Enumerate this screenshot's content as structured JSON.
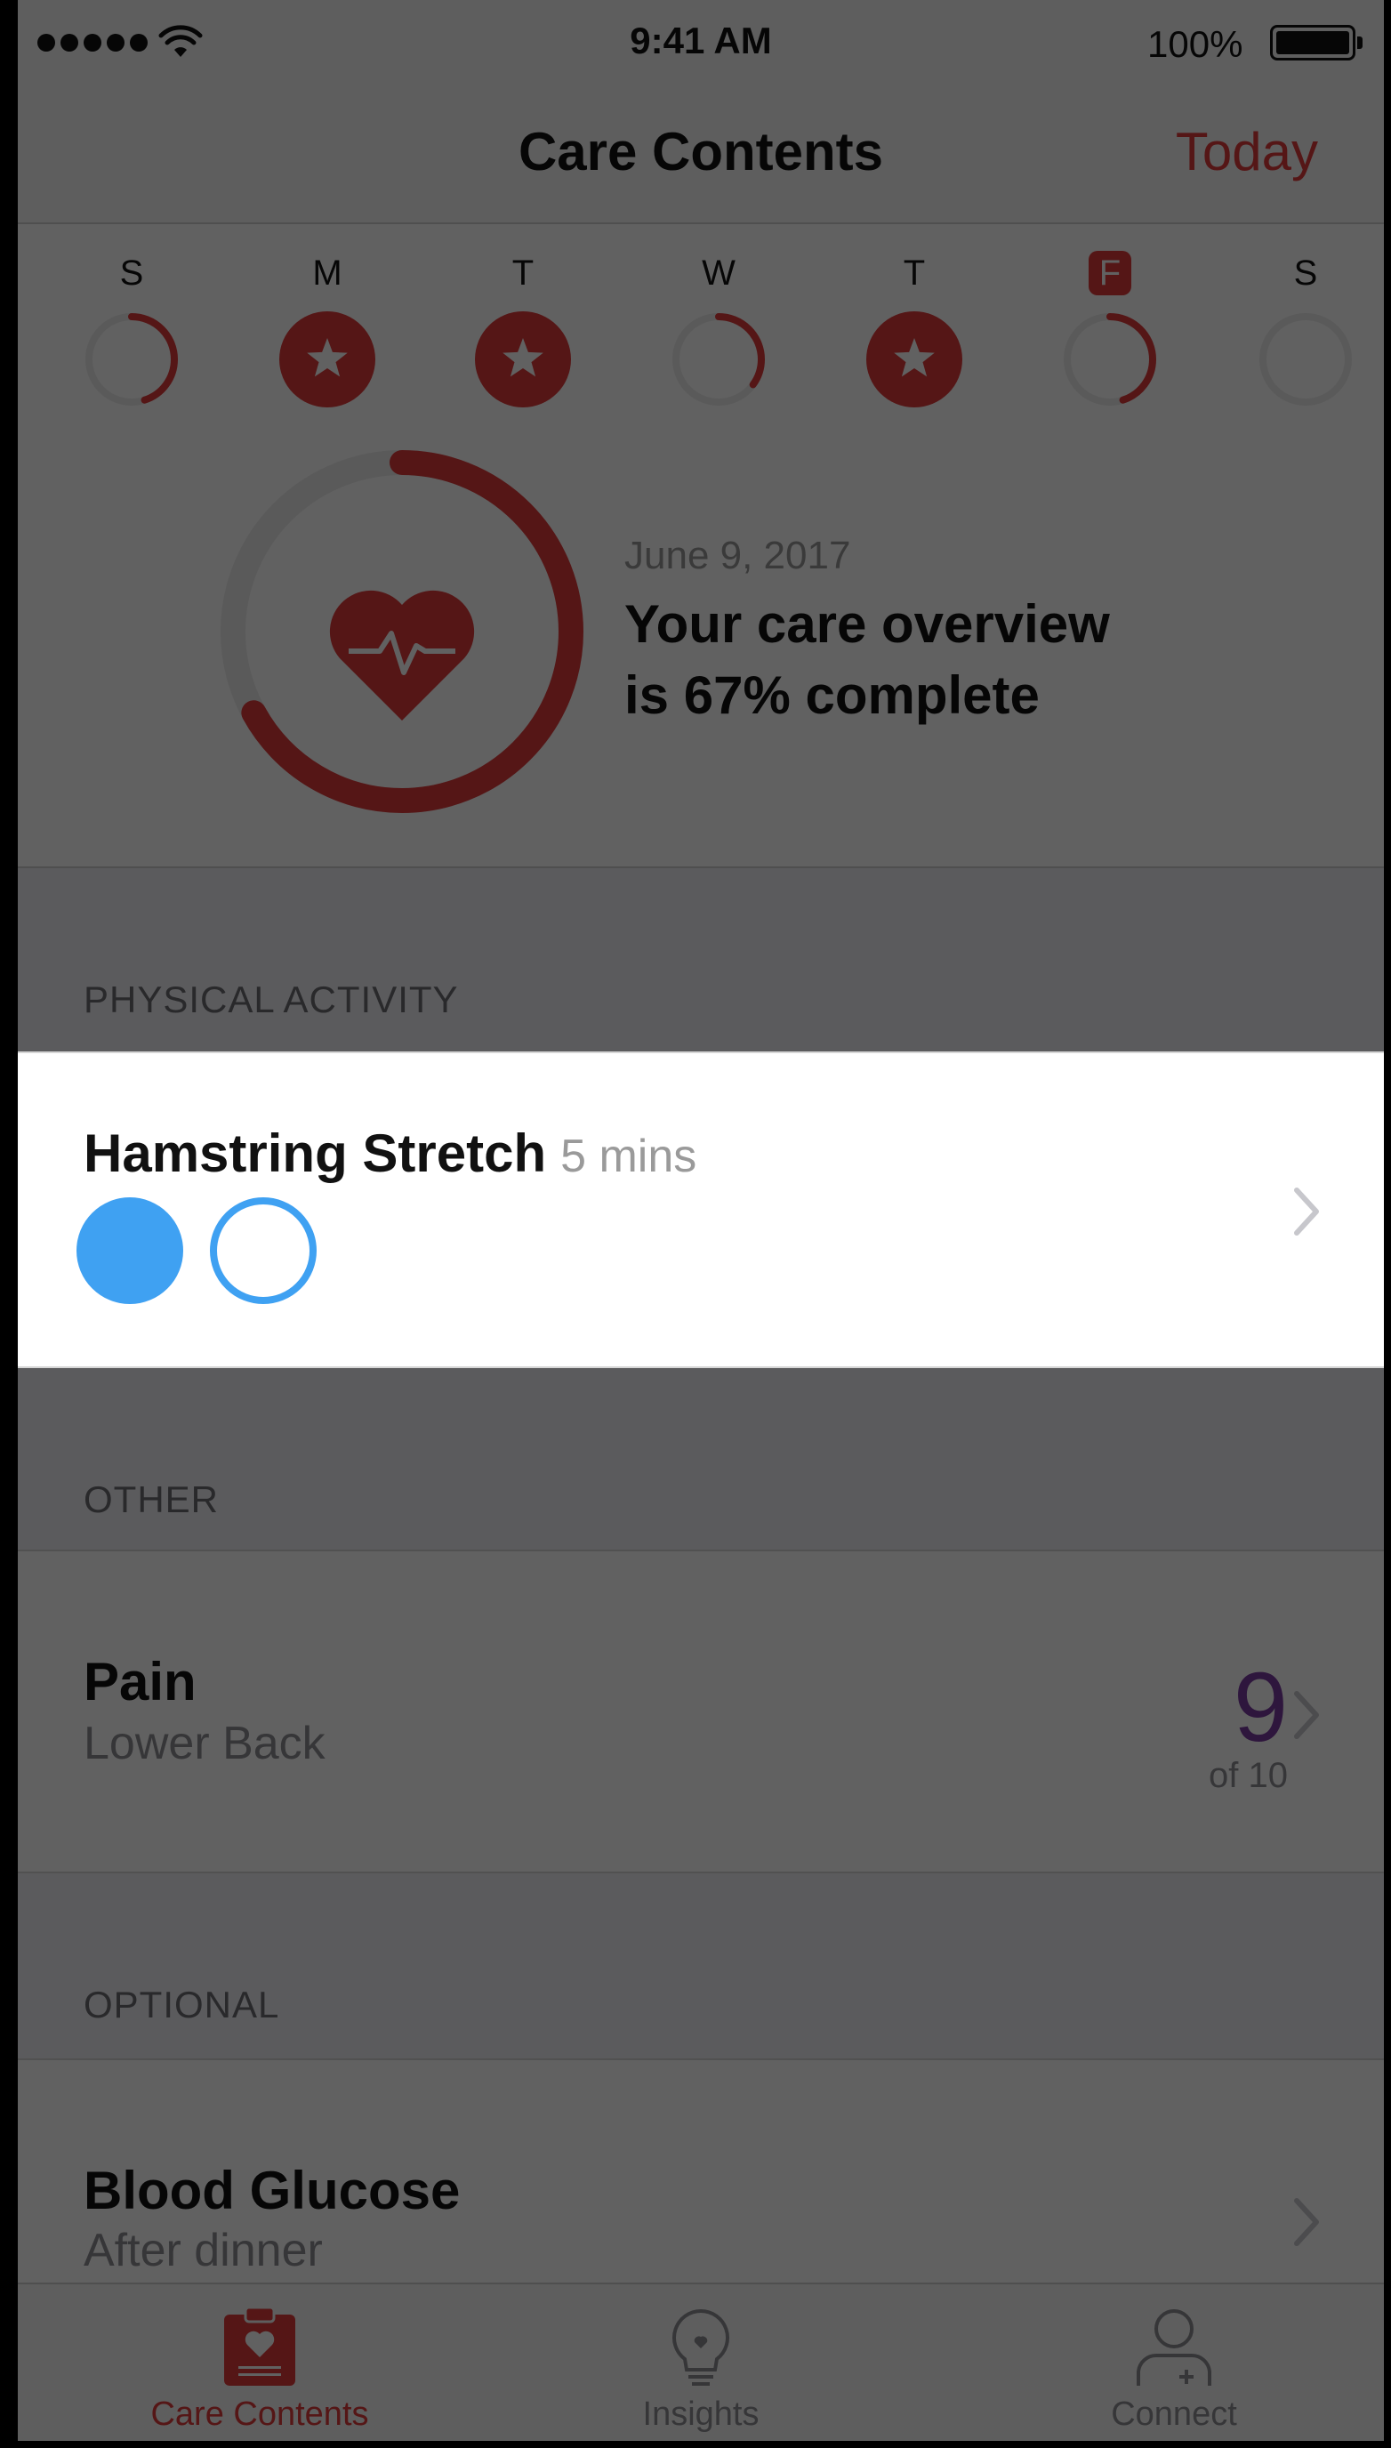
{
  "status_bar": {
    "time": "9:41 AM",
    "battery_percent": "100%",
    "signal_bars": 5
  },
  "nav": {
    "title": "Care Contents",
    "today_label": "Today"
  },
  "colors": {
    "accent": "#e03a3a",
    "event_blue": "#3fa1f2",
    "pain_purple": "#7a3aa0"
  },
  "week": {
    "days": [
      {
        "letter": "S",
        "state": "partial",
        "progress": 0.45,
        "selected": false
      },
      {
        "letter": "M",
        "state": "complete",
        "progress": 1.0,
        "selected": false
      },
      {
        "letter": "T",
        "state": "complete",
        "progress": 1.0,
        "selected": false
      },
      {
        "letter": "W",
        "state": "partial",
        "progress": 0.35,
        "selected": false
      },
      {
        "letter": "T",
        "state": "complete",
        "progress": 1.0,
        "selected": false
      },
      {
        "letter": "F",
        "state": "partial",
        "progress": 0.45,
        "selected": true
      },
      {
        "letter": "S",
        "state": "empty",
        "progress": 0.0,
        "selected": false
      }
    ]
  },
  "overview": {
    "date": "June 9, 2017",
    "line1": "Your care overview",
    "line2": "is 67% complete",
    "progress": 0.67,
    "icon": "heart-pulse-icon"
  },
  "sections": {
    "physical_activity": {
      "title": "PHYSICAL ACTIVITY",
      "activity": {
        "name": "Hamstring Stretch",
        "duration": "5 mins",
        "events_done": 1,
        "events_total": 2
      }
    },
    "other": {
      "title": "OTHER",
      "assessment": {
        "name": "Pain",
        "subtitle": "Lower Back",
        "value": "9",
        "of_label": "of 10"
      }
    },
    "optional": {
      "title": "OPTIONAL",
      "assessment": {
        "name": "Blood Glucose",
        "subtitle": "After dinner"
      }
    }
  },
  "tabs": [
    {
      "label": "Care Contents",
      "icon": "clipboard-heart-icon",
      "active": true
    },
    {
      "label": "Insights",
      "icon": "lightbulb-icon",
      "active": false
    },
    {
      "label": "Connect",
      "icon": "person-plus-icon",
      "active": false
    }
  ]
}
